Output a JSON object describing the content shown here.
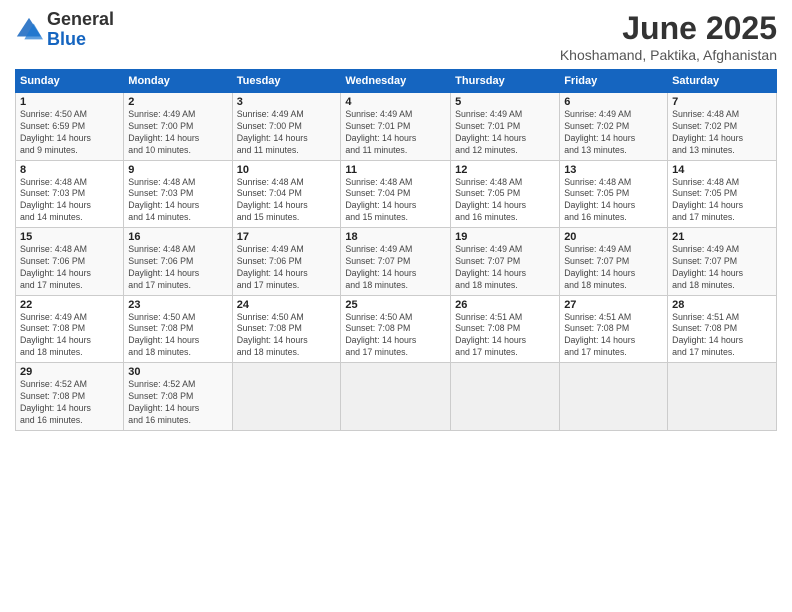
{
  "header": {
    "logo_general": "General",
    "logo_blue": "Blue",
    "month_title": "June 2025",
    "subtitle": "Khoshamand, Paktika, Afghanistan"
  },
  "weekdays": [
    "Sunday",
    "Monday",
    "Tuesday",
    "Wednesday",
    "Thursday",
    "Friday",
    "Saturday"
  ],
  "weeks": [
    [
      {
        "day": "1",
        "detail": "Sunrise: 4:50 AM\nSunset: 6:59 PM\nDaylight: 14 hours\nand 9 minutes."
      },
      {
        "day": "2",
        "detail": "Sunrise: 4:49 AM\nSunset: 7:00 PM\nDaylight: 14 hours\nand 10 minutes."
      },
      {
        "day": "3",
        "detail": "Sunrise: 4:49 AM\nSunset: 7:00 PM\nDaylight: 14 hours\nand 11 minutes."
      },
      {
        "day": "4",
        "detail": "Sunrise: 4:49 AM\nSunset: 7:01 PM\nDaylight: 14 hours\nand 11 minutes."
      },
      {
        "day": "5",
        "detail": "Sunrise: 4:49 AM\nSunset: 7:01 PM\nDaylight: 14 hours\nand 12 minutes."
      },
      {
        "day": "6",
        "detail": "Sunrise: 4:49 AM\nSunset: 7:02 PM\nDaylight: 14 hours\nand 13 minutes."
      },
      {
        "day": "7",
        "detail": "Sunrise: 4:48 AM\nSunset: 7:02 PM\nDaylight: 14 hours\nand 13 minutes."
      }
    ],
    [
      {
        "day": "8",
        "detail": "Sunrise: 4:48 AM\nSunset: 7:03 PM\nDaylight: 14 hours\nand 14 minutes."
      },
      {
        "day": "9",
        "detail": "Sunrise: 4:48 AM\nSunset: 7:03 PM\nDaylight: 14 hours\nand 14 minutes."
      },
      {
        "day": "10",
        "detail": "Sunrise: 4:48 AM\nSunset: 7:04 PM\nDaylight: 14 hours\nand 15 minutes."
      },
      {
        "day": "11",
        "detail": "Sunrise: 4:48 AM\nSunset: 7:04 PM\nDaylight: 14 hours\nand 15 minutes."
      },
      {
        "day": "12",
        "detail": "Sunrise: 4:48 AM\nSunset: 7:05 PM\nDaylight: 14 hours\nand 16 minutes."
      },
      {
        "day": "13",
        "detail": "Sunrise: 4:48 AM\nSunset: 7:05 PM\nDaylight: 14 hours\nand 16 minutes."
      },
      {
        "day": "14",
        "detail": "Sunrise: 4:48 AM\nSunset: 7:05 PM\nDaylight: 14 hours\nand 17 minutes."
      }
    ],
    [
      {
        "day": "15",
        "detail": "Sunrise: 4:48 AM\nSunset: 7:06 PM\nDaylight: 14 hours\nand 17 minutes."
      },
      {
        "day": "16",
        "detail": "Sunrise: 4:48 AM\nSunset: 7:06 PM\nDaylight: 14 hours\nand 17 minutes."
      },
      {
        "day": "17",
        "detail": "Sunrise: 4:49 AM\nSunset: 7:06 PM\nDaylight: 14 hours\nand 17 minutes."
      },
      {
        "day": "18",
        "detail": "Sunrise: 4:49 AM\nSunset: 7:07 PM\nDaylight: 14 hours\nand 18 minutes."
      },
      {
        "day": "19",
        "detail": "Sunrise: 4:49 AM\nSunset: 7:07 PM\nDaylight: 14 hours\nand 18 minutes."
      },
      {
        "day": "20",
        "detail": "Sunrise: 4:49 AM\nSunset: 7:07 PM\nDaylight: 14 hours\nand 18 minutes."
      },
      {
        "day": "21",
        "detail": "Sunrise: 4:49 AM\nSunset: 7:07 PM\nDaylight: 14 hours\nand 18 minutes."
      }
    ],
    [
      {
        "day": "22",
        "detail": "Sunrise: 4:49 AM\nSunset: 7:08 PM\nDaylight: 14 hours\nand 18 minutes."
      },
      {
        "day": "23",
        "detail": "Sunrise: 4:50 AM\nSunset: 7:08 PM\nDaylight: 14 hours\nand 18 minutes."
      },
      {
        "day": "24",
        "detail": "Sunrise: 4:50 AM\nSunset: 7:08 PM\nDaylight: 14 hours\nand 18 minutes."
      },
      {
        "day": "25",
        "detail": "Sunrise: 4:50 AM\nSunset: 7:08 PM\nDaylight: 14 hours\nand 17 minutes."
      },
      {
        "day": "26",
        "detail": "Sunrise: 4:51 AM\nSunset: 7:08 PM\nDaylight: 14 hours\nand 17 minutes."
      },
      {
        "day": "27",
        "detail": "Sunrise: 4:51 AM\nSunset: 7:08 PM\nDaylight: 14 hours\nand 17 minutes."
      },
      {
        "day": "28",
        "detail": "Sunrise: 4:51 AM\nSunset: 7:08 PM\nDaylight: 14 hours\nand 17 minutes."
      }
    ],
    [
      {
        "day": "29",
        "detail": "Sunrise: 4:52 AM\nSunset: 7:08 PM\nDaylight: 14 hours\nand 16 minutes."
      },
      {
        "day": "30",
        "detail": "Sunrise: 4:52 AM\nSunset: 7:08 PM\nDaylight: 14 hours\nand 16 minutes."
      },
      {
        "day": "",
        "detail": ""
      },
      {
        "day": "",
        "detail": ""
      },
      {
        "day": "",
        "detail": ""
      },
      {
        "day": "",
        "detail": ""
      },
      {
        "day": "",
        "detail": ""
      }
    ]
  ]
}
